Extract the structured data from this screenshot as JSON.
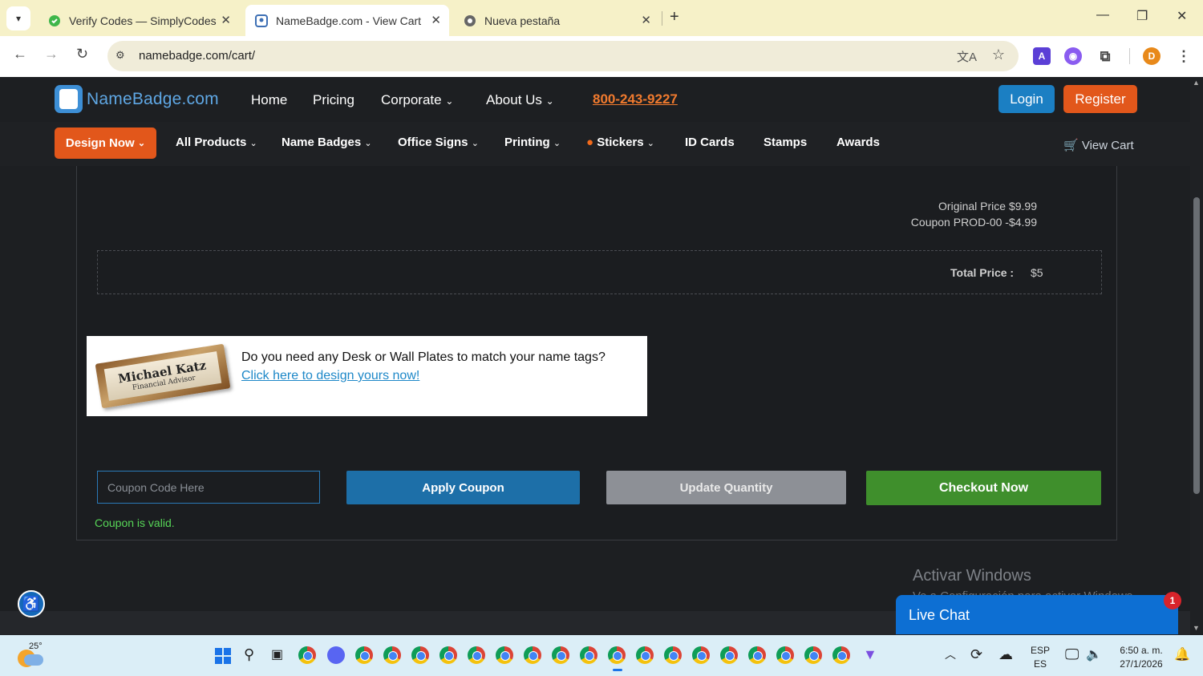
{
  "browser": {
    "tabs": [
      {
        "title": "Verify Codes — SimplyCodes",
        "active": false
      },
      {
        "title": "NameBadge.com - View Cart",
        "active": true
      },
      {
        "title": "Nueva pestaña",
        "active": false
      }
    ],
    "url": "namebadge.com/cart/",
    "profile_initial": "D"
  },
  "site": {
    "logo_text": "NameBadge.com",
    "top_nav": [
      "Home",
      "Pricing",
      "Corporate",
      "About Us"
    ],
    "phone": "800-243-9227",
    "login_label": "Login",
    "register_label": "Register",
    "design_now_label": "Design Now",
    "sub_nav": [
      "All Products",
      "Name Badges",
      "Office Signs",
      "Printing",
      "Stickers",
      "ID Cards",
      "Stamps",
      "Awards"
    ],
    "view_cart_label": "View Cart"
  },
  "cart": {
    "original_price_line": "Original Price $9.99",
    "coupon_line": "Coupon PROD-00 -$4.99",
    "total_label": "Total Price :",
    "total_value": "$5",
    "promo_name": "Michael Katz",
    "promo_title": "Financial Advisor",
    "promo_question": "Do you need any Desk or Wall Plates to match your name tags?",
    "promo_link": "Click here to design yours now!",
    "coupon_placeholder": "Coupon Code Here",
    "apply_label": "Apply Coupon",
    "update_label": "Update Quantity",
    "checkout_label": "Checkout Now",
    "coupon_status": "Coupon is valid."
  },
  "overlay": {
    "watermark_title": "Activar Windows",
    "watermark_sub": "Ve a Configuración para activar Windows.",
    "live_chat_label": "Live Chat",
    "live_chat_badge": "1"
  },
  "taskbar": {
    "temperature": "25°",
    "lang_top": "ESP",
    "lang_bottom": "ES",
    "time": "6:50 a. m.",
    "date": "27/1/2026"
  },
  "colors": {
    "accent_orange": "#e2571b",
    "accent_blue": "#1b7fc3",
    "checkout_green": "#3f8f2c",
    "valid_green": "#57d657"
  }
}
